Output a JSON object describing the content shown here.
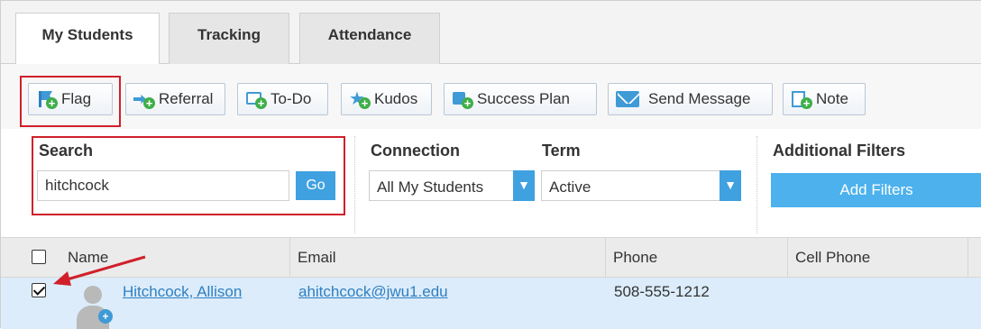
{
  "tabs": [
    {
      "label": "My Students",
      "active": true
    },
    {
      "label": "Tracking",
      "active": false
    },
    {
      "label": "Attendance",
      "active": false
    }
  ],
  "toolbar": {
    "buttons": [
      {
        "label": "Flag",
        "icon": "flag-icon"
      },
      {
        "label": "Referral",
        "icon": "referral-icon"
      },
      {
        "label": "To-Do",
        "icon": "todo-icon"
      },
      {
        "label": "Kudos",
        "icon": "kudos-icon"
      },
      {
        "label": "Success Plan",
        "icon": "success-plan-icon"
      },
      {
        "label": "Send Message",
        "icon": "mail-icon"
      },
      {
        "label": "Note",
        "icon": "note-icon"
      }
    ]
  },
  "filters": {
    "search": {
      "label": "Search",
      "value": "hitchcock",
      "go_label": "Go"
    },
    "connection": {
      "label": "Connection",
      "value": "All My Students"
    },
    "term": {
      "label": "Term",
      "value": "Active"
    },
    "additional": {
      "label": "Additional Filters",
      "button_label": "Add Filters"
    }
  },
  "table": {
    "columns": [
      "Name",
      "Email",
      "Phone",
      "Cell Phone"
    ],
    "rows": [
      {
        "name": "Hitchcock, Allison",
        "email": "ahitchcock@jwu1.edu",
        "phone": "508-555-1212",
        "cell_phone": "",
        "selected": true
      }
    ]
  },
  "colors": {
    "accent": "#3fa1e0",
    "highlight": "#d0202a",
    "row_selected": "#dcecfa",
    "link": "#2f7fc1"
  }
}
